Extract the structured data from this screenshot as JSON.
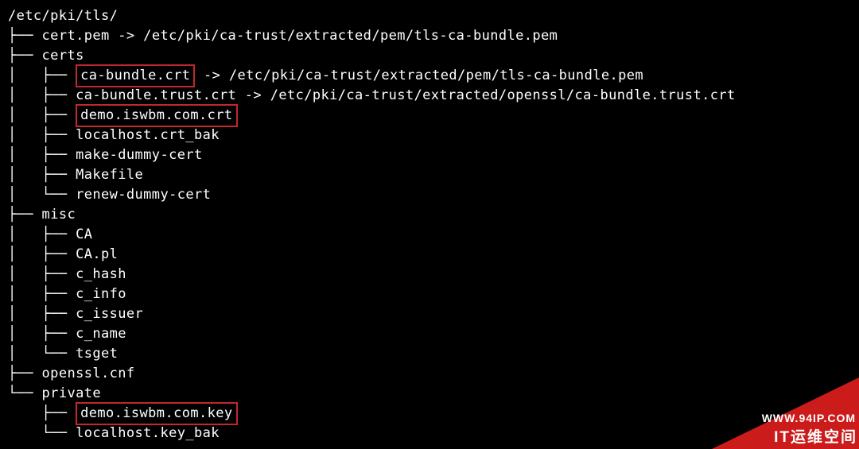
{
  "url_text": "WWW.94IP.COM",
  "cn_text": "IT运维空间",
  "lines": [
    {
      "pre": "",
      "text": "/etc/pki/tls/",
      "post": "",
      "hl": false
    },
    {
      "pre": "├── ",
      "text": "cert.pem",
      "post": " -> /etc/pki/ca-trust/extracted/pem/tls-ca-bundle.pem",
      "hl": false
    },
    {
      "pre": "├── ",
      "text": "certs",
      "post": "",
      "hl": false
    },
    {
      "pre": "│   ├── ",
      "text": "ca-bundle.crt",
      "post": " -> /etc/pki/ca-trust/extracted/pem/tls-ca-bundle.pem",
      "hl": true
    },
    {
      "pre": "│   ├── ",
      "text": "ca-bundle.trust.crt",
      "post": " -> /etc/pki/ca-trust/extracted/openssl/ca-bundle.trust.crt",
      "hl": false
    },
    {
      "pre": "│   ├── ",
      "text": "demo.iswbm.com.crt",
      "post": "",
      "hl": true
    },
    {
      "pre": "│   ├── ",
      "text": "localhost.crt_bak",
      "post": "",
      "hl": false
    },
    {
      "pre": "│   ├── ",
      "text": "make-dummy-cert",
      "post": "",
      "hl": false
    },
    {
      "pre": "│   ├── ",
      "text": "Makefile",
      "post": "",
      "hl": false
    },
    {
      "pre": "│   └── ",
      "text": "renew-dummy-cert",
      "post": "",
      "hl": false
    },
    {
      "pre": "├── ",
      "text": "misc",
      "post": "",
      "hl": false
    },
    {
      "pre": "│   ├── ",
      "text": "CA",
      "post": "",
      "hl": false
    },
    {
      "pre": "│   ├── ",
      "text": "CA.pl",
      "post": "",
      "hl": false
    },
    {
      "pre": "│   ├── ",
      "text": "c_hash",
      "post": "",
      "hl": false
    },
    {
      "pre": "│   ├── ",
      "text": "c_info",
      "post": "",
      "hl": false
    },
    {
      "pre": "│   ├── ",
      "text": "c_issuer",
      "post": "",
      "hl": false
    },
    {
      "pre": "│   ├── ",
      "text": "c_name",
      "post": "",
      "hl": false
    },
    {
      "pre": "│   └── ",
      "text": "tsget",
      "post": "",
      "hl": false
    },
    {
      "pre": "├── ",
      "text": "openssl.cnf",
      "post": "",
      "hl": false
    },
    {
      "pre": "└── ",
      "text": "private",
      "post": "",
      "hl": false
    },
    {
      "pre": "    ├── ",
      "text": "demo.iswbm.com.key",
      "post": "",
      "hl": true
    },
    {
      "pre": "    └── ",
      "text": "localhost.key_bak",
      "post": "",
      "hl": false
    }
  ]
}
